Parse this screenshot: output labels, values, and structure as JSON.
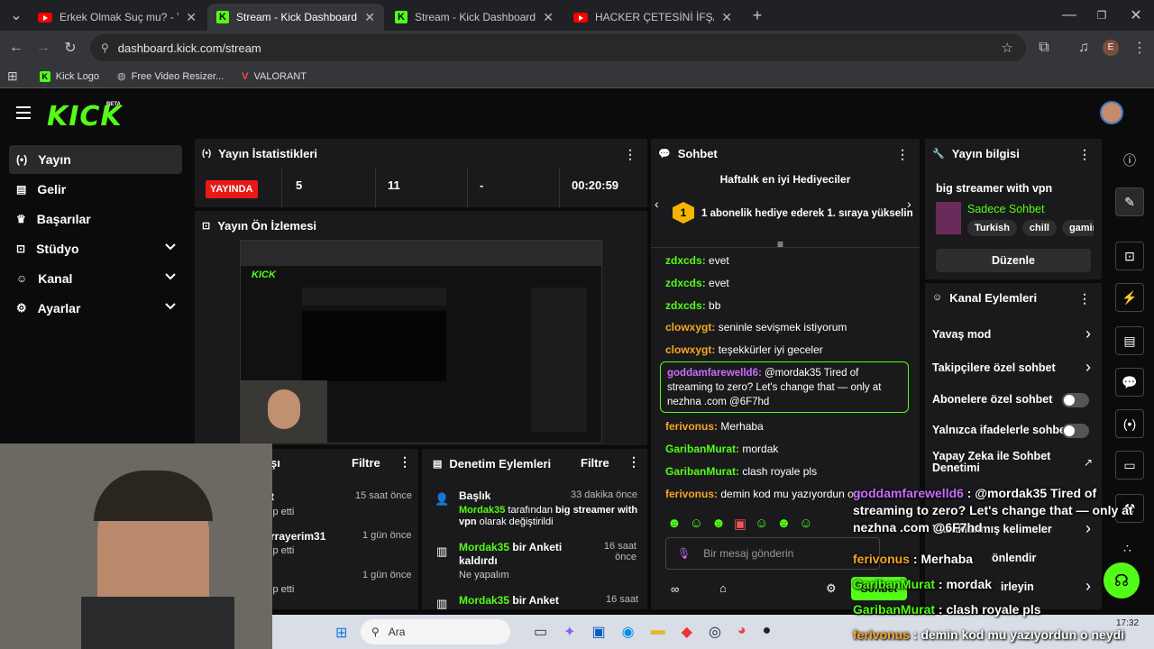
{
  "browser": {
    "tabs": [
      {
        "title": "Erkek Olmak Suç mu? - YouTube",
        "icon": "youtube-icon"
      },
      {
        "title": "Stream - Kick Dashboard",
        "icon": "kick-icon",
        "active": true
      },
      {
        "title": "Stream - Kick Dashboard",
        "icon": "kick-icon"
      },
      {
        "title": "HACKER ÇETESİNİ İFŞALIYORUM",
        "icon": "youtube-icon"
      }
    ],
    "url": "dashboard.kick.com/stream",
    "profile_initial": "E",
    "bookmarks": [
      {
        "label": "Kick Logo"
      },
      {
        "label": "Free Video Resizer..."
      },
      {
        "label": "VALORANT"
      }
    ]
  },
  "kick": {
    "logo": "KICK",
    "beta": "BETA",
    "nav": [
      {
        "label": "Yayın",
        "icon": "broadcast-icon",
        "active": true
      },
      {
        "label": "Gelir",
        "icon": "chart-icon"
      },
      {
        "label": "Başarılar",
        "icon": "trophy-icon"
      },
      {
        "label": "Stüdyo",
        "icon": "studio-icon",
        "expandable": true
      },
      {
        "label": "Kanal",
        "icon": "users-icon",
        "expandable": true
      },
      {
        "label": "Ayarlar",
        "icon": "gear-icon",
        "expandable": true
      }
    ],
    "stats": {
      "title": "Yayın İstatistikleri",
      "status": "YAYINDA",
      "viewers": "5",
      "followers": "11",
      "subs": "-",
      "uptime": "00:20:59"
    },
    "preview": {
      "title": "Yayın Ön İzlemesi"
    },
    "activity": {
      "title_partial": "şı",
      "filter": "Filtre",
      "items": [
        {
          "name": "t",
          "sub": "ip etti",
          "time": "15 saat önce"
        },
        {
          "name": "rrayerim31",
          "sub": "ip etti",
          "time": "1 gün önce"
        },
        {
          "name": "",
          "sub": "ip etti",
          "time": "1 gün önce"
        }
      ]
    },
    "moderation": {
      "title": "Denetim Eylemleri",
      "filter": "Filtre",
      "items": [
        {
          "icon": "user-icon",
          "title": "Başlık",
          "time": "33 dakika önce",
          "user": "Mordak35",
          "text1": " tarafından ",
          "bold": "big streamer with vpn",
          "text2": " olarak değiştirildi"
        },
        {
          "icon": "poll-icon",
          "user": "Mordak35",
          "title": " bir Anketi kaldırdı",
          "sub": "Ne yapalım",
          "time": "16 saat önce"
        },
        {
          "icon": "poll-icon",
          "user": "Mordak35",
          "title": " bir Anket",
          "time": "16 saat"
        }
      ]
    },
    "chat": {
      "title": "Sohbet",
      "top_gifters": "Haftalık en iyi Hediyeciler",
      "gifter_rank": "1",
      "gifter_text": "1 abonelik hediye ederek 1. sıraya yükselin",
      "messages": [
        {
          "user": "zdxcds",
          "text": "evet",
          "color": "#53fc18"
        },
        {
          "user": "zdxcds",
          "text": "evet",
          "color": "#53fc18"
        },
        {
          "user": "zdxcds",
          "text": "bb",
          "color": "#53fc18"
        },
        {
          "user": "clowxygt",
          "text": "seninle sevişmek istiyorum",
          "color": "#f5a623"
        },
        {
          "user": "clowxygt",
          "text": "teşekkürler iyi geceler",
          "color": "#f5a623"
        },
        {
          "user": "goddamfarewelld6",
          "text": "@mordak35 Tired of streaming to zero? Let's change that — only at nezhna .com @6F7hd",
          "color": "#c96dfd",
          "highlight": true
        },
        {
          "user": "ferivonus",
          "text": "Merhaba",
          "color": "#f5a623"
        },
        {
          "user": "GaribanMurat",
          "text": "mordak",
          "color": "#53fc18"
        },
        {
          "user": "GaribanMurat",
          "text": "clash royale pls",
          "color": "#53fc18"
        },
        {
          "user": "ferivonus",
          "text": "demin kod mu yazıyordun o n",
          "color": "#f5a623"
        }
      ],
      "input_placeholder": "Bir mesaj gönderin",
      "send_label": "Sohbet"
    },
    "stream_info": {
      "title": "Yayın bilgisi",
      "stream_title": "big streamer with vpn",
      "category": "Sadece Sohbet",
      "tags": [
        "Turkish",
        "chill",
        "gaming"
      ],
      "edit_label": "Düzenle"
    },
    "channel_actions": {
      "title": "Kanal Eylemleri",
      "items": [
        {
          "label": "Yavaş mod",
          "type": "arrow"
        },
        {
          "label": "Takipçilere özel sohbet",
          "type": "arrow"
        },
        {
          "label": "Abonelere özel sohbet",
          "type": "toggle"
        },
        {
          "label": "Yalnızca ifadelerle sohbet",
          "type": "toggle"
        },
        {
          "label": "Yapay Zeka ile Sohbet Denetimi",
          "type": "external"
        },
        {
          "label": "Yasaklanmış kelimeler",
          "type": "arrow"
        },
        {
          "label": "önlendir",
          "type": "none"
        },
        {
          "label": "irleyin",
          "type": "arrow"
        }
      ]
    }
  },
  "overlay": {
    "lines": [
      {
        "user": "goddamfarewelld6",
        "text": " : @mordak35 Tired of streaming to zero? Let's change that — only at nezhna .com @6F7hd",
        "color": "#c96dfd"
      },
      {
        "user": "ferivonus",
        "text": " : Merhaba",
        "color": "#f5a623"
      },
      {
        "user": "GaribanMurat",
        "text": " : mordak",
        "color": "#53fc18"
      },
      {
        "user": "GaribanMurat",
        "text": " : clash royale pls",
        "color": "#53fc18"
      },
      {
        "user": "ferivonus",
        "text": " : demin kod mu yazıyordun o neydi",
        "color": "#f5a623"
      }
    ]
  },
  "taskbar": {
    "search": "Ara",
    "time": "17:32"
  },
  "colors": {
    "accent": "#53fc18",
    "live": "#e91916",
    "panel": "#1a1a1c"
  }
}
